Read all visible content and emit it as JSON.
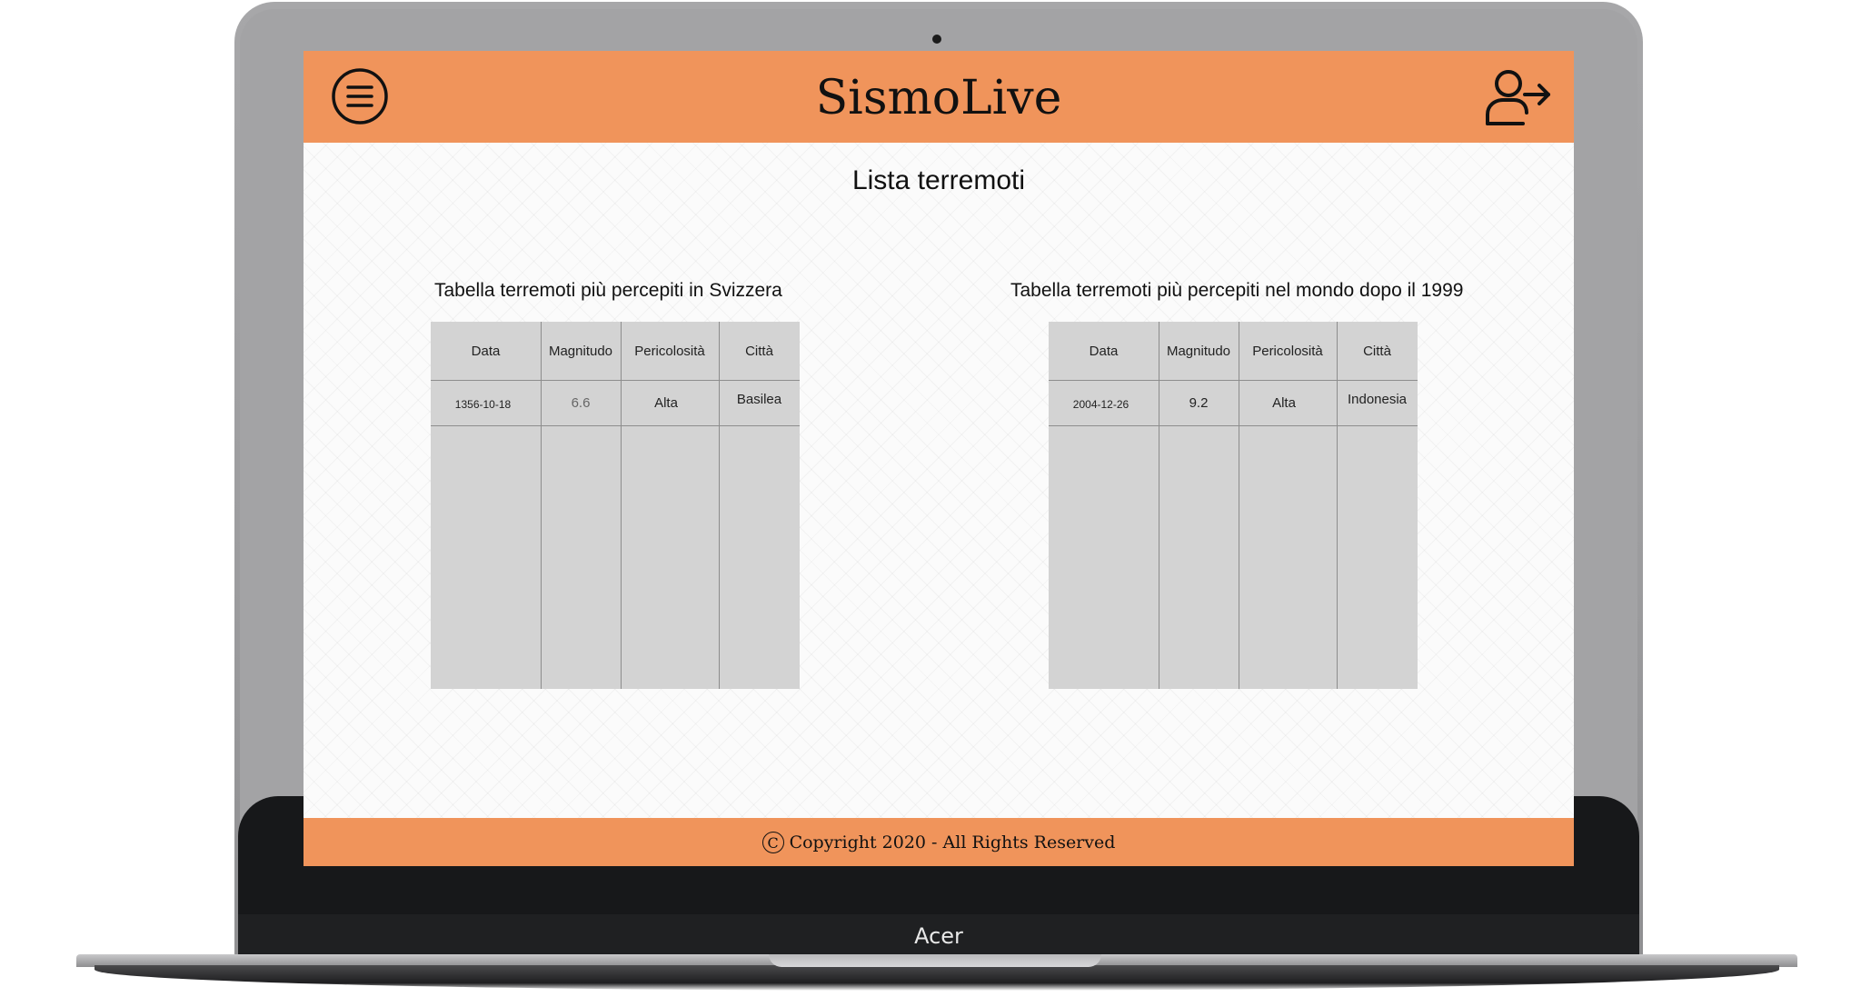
{
  "device": {
    "brand": "Acer"
  },
  "header": {
    "app_title": "SismoLive",
    "menu_icon": "hamburger-menu-icon",
    "logout_icon": "user-logout-icon"
  },
  "main": {
    "page_title": "Lista terremoti",
    "tables": [
      {
        "caption": "Tabella terremoti più percepiti in Svizzera",
        "columns": [
          "Data",
          "Magnitudo",
          "Pericolosità",
          "Città"
        ],
        "rows": [
          [
            "1356-10-18",
            "6.6",
            "Alta",
            "Basilea"
          ]
        ]
      },
      {
        "caption": "Tabella terremoti più percepiti nel mondo dopo il 1999",
        "columns": [
          "Data",
          "Magnitudo",
          "Pericolosità",
          "Città"
        ],
        "rows": [
          [
            "2004-12-26",
            "9.2",
            "Alta",
            "Indonesia"
          ]
        ]
      }
    ]
  },
  "footer": {
    "copyright_symbol": "C",
    "text": "Copyright 2020 - All Rights Reserved"
  },
  "colors": {
    "header_footer": "#f0945b",
    "table_background": "#d3d3d3",
    "page_background": "#fbfbfb"
  }
}
